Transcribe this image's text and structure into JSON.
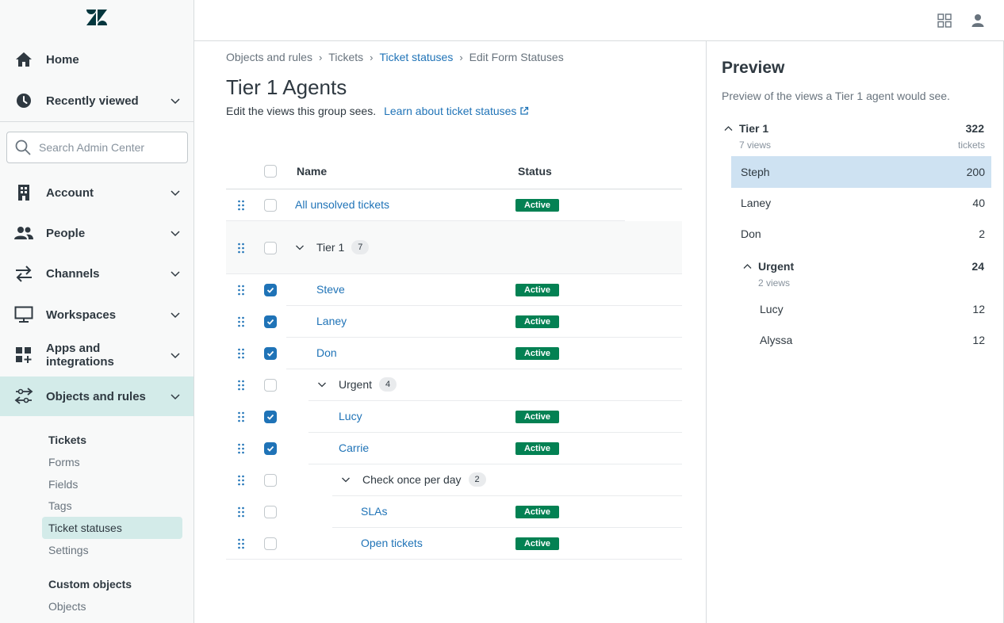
{
  "sidebar": {
    "logo": "zendesk-logo",
    "items": [
      {
        "label": "Home",
        "icon": "home-icon"
      },
      {
        "label": "Recently viewed",
        "icon": "clock-icon"
      },
      {
        "label": "Account",
        "icon": "building-icon"
      },
      {
        "label": "People",
        "icon": "people-icon"
      },
      {
        "label": "Channels",
        "icon": "arrows-icon"
      },
      {
        "label": "Workspaces",
        "icon": "monitor-icon"
      },
      {
        "label": "Apps and integrations",
        "icon": "apps-icon"
      },
      {
        "label": "Objects and rules",
        "icon": "objects-rules-icon"
      }
    ],
    "search_placeholder": "Search Admin Center",
    "tickets_heading": "Tickets",
    "tickets_items": [
      "Forms",
      "Fields",
      "Tags",
      "Ticket statuses",
      "Settings"
    ],
    "custom_heading": "Custom objects",
    "custom_items": [
      "Objects"
    ]
  },
  "breadcrumb": [
    "Objects and rules",
    "Tickets",
    "Ticket statuses",
    "Edit Form Statuses"
  ],
  "page": {
    "title": "Tier 1 Agents",
    "description": "Edit the views this group sees.",
    "learn_link": "Learn about ticket statuses"
  },
  "table": {
    "col_name": "Name",
    "col_status": "Status",
    "rows": [
      {
        "name": "All unsolved tickets",
        "status": "Active",
        "checked": false
      },
      {
        "group": "Tier 1",
        "count": "7"
      },
      {
        "name": "Steve",
        "status": "Active",
        "checked": true
      },
      {
        "name": "Laney",
        "status": "Active",
        "checked": true
      },
      {
        "name": "Don",
        "status": "Active",
        "checked": true
      },
      {
        "group": "Urgent",
        "count": "4"
      },
      {
        "name": "Lucy",
        "status": "Active",
        "checked": true
      },
      {
        "name": "Carrie",
        "status": "Active",
        "checked": true
      },
      {
        "group": "Check once per day",
        "count": "2"
      },
      {
        "name": "SLAs",
        "status": "Active",
        "checked": false
      },
      {
        "name": "Open tickets",
        "status": "Active",
        "checked": false
      }
    ]
  },
  "preview": {
    "title": "Preview",
    "description": "Preview of the views a Tier 1 agent would see.",
    "tier1": {
      "label": "Tier 1",
      "views": "7 views",
      "count": "322",
      "count_unit": "tickets"
    },
    "tier1_items": [
      {
        "label": "Steph",
        "count": "200"
      },
      {
        "label": "Laney",
        "count": "40"
      },
      {
        "label": "Don",
        "count": "2"
      }
    ],
    "urgent": {
      "label": "Urgent",
      "views": "2 views",
      "count": "24"
    },
    "urgent_items": [
      {
        "label": "Lucy",
        "count": "12"
      },
      {
        "label": "Alyssa",
        "count": "12"
      }
    ]
  },
  "colors": {
    "accent": "#1f73b7",
    "active_badge": "#038153",
    "nav_selected": "#d3ebe9",
    "preview_selected": "#cee2f2"
  }
}
